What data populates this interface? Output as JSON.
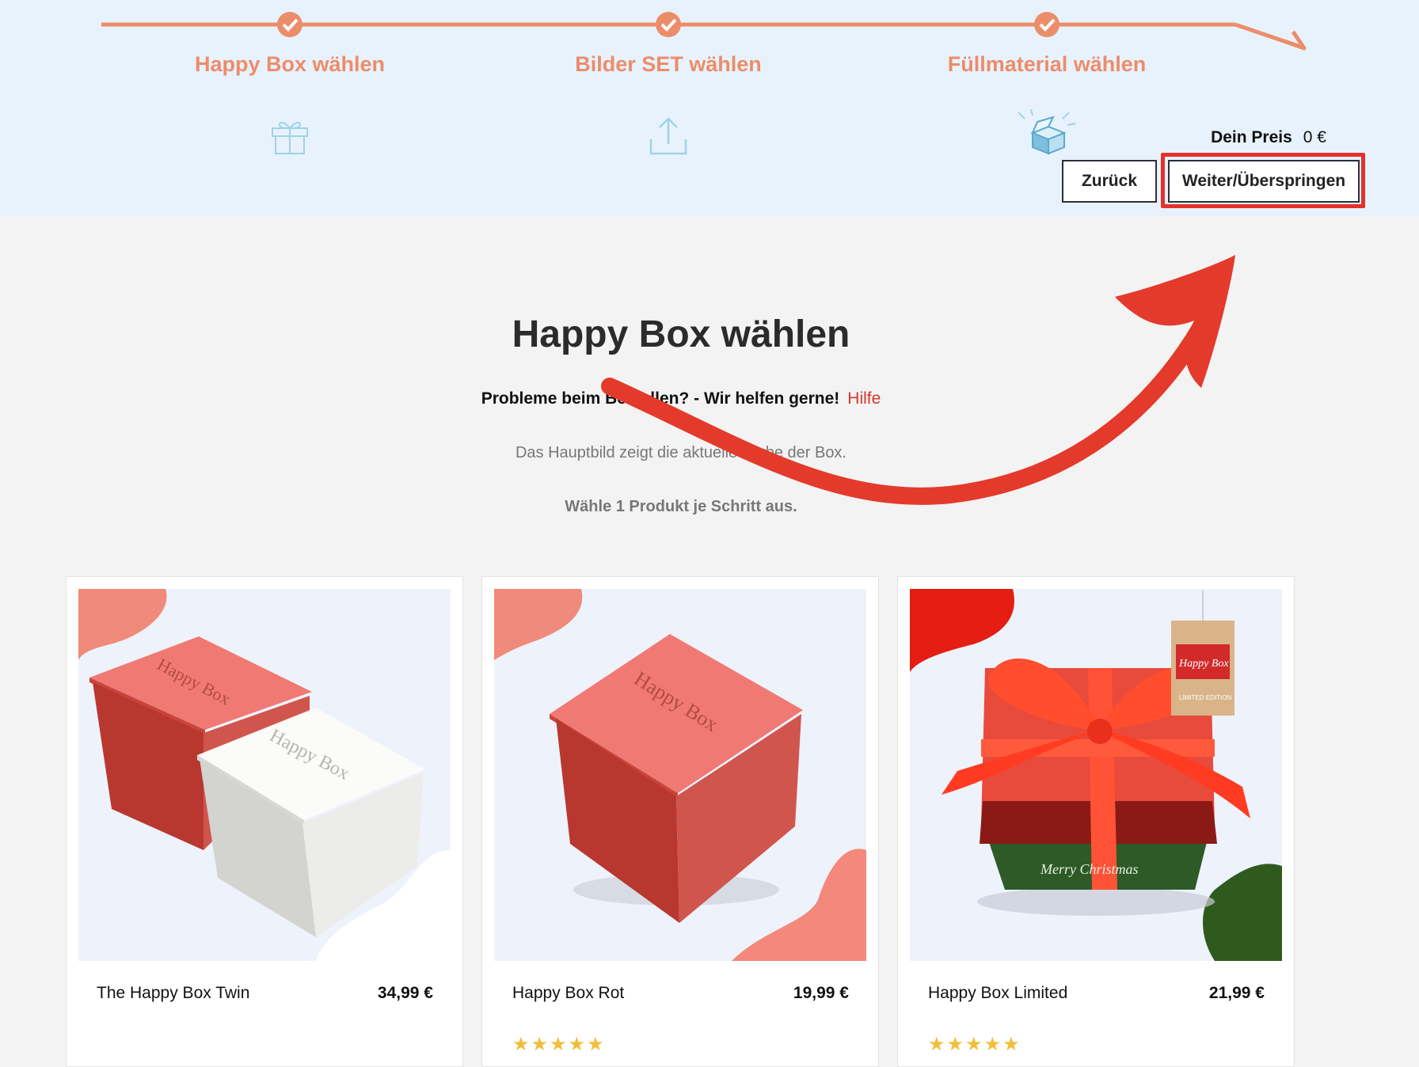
{
  "steps": [
    {
      "label": "Happy Box wählen",
      "icon": "gift-icon"
    },
    {
      "label": "Bilder SET wählen",
      "icon": "upload-icon"
    },
    {
      "label": "Füllmaterial wählen",
      "icon": "open-box-icon"
    }
  ],
  "price": {
    "label": "Dein Preis",
    "value": "0 €"
  },
  "buttons": {
    "back": "Zurück",
    "next": "Weiter/Überspringen"
  },
  "main": {
    "title": "Happy Box wählen",
    "help_text": "Probleme beim Bestellen? - Wir helfen gerne!",
    "help_link": "Hilfe",
    "info": "Das Hauptbild zeigt die aktuelle Farbe der Box.",
    "instruction": "Wähle 1 Produkt je Schritt aus."
  },
  "products": [
    {
      "name": "The Happy Box Twin",
      "price": "34,99 €",
      "stars": ""
    },
    {
      "name": "Happy Box Rot",
      "price": "19,99 €",
      "stars": "★★★★★"
    },
    {
      "name": "Happy Box Limited",
      "price": "21,99 €",
      "stars": "★★★★★"
    }
  ],
  "box_print": "Happy Box",
  "tag_text": {
    "title": "Happy Box",
    "edition": "LIMITED EDITION"
  },
  "ribbon_text": "Merry Christmas",
  "colors": {
    "accent": "#ec8d6a",
    "header_bg": "#e8f2fd",
    "highlight": "#e3322b",
    "link": "#d8342b",
    "star": "#f0bf3a"
  }
}
